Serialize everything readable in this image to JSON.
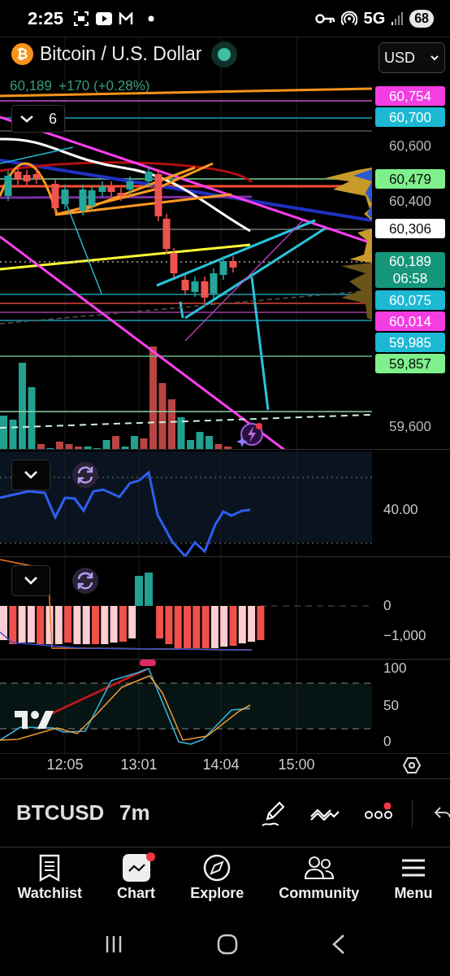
{
  "status_bar": {
    "time": "2:25",
    "network": "5G",
    "battery": "68"
  },
  "header": {
    "symbol_icon": "₿",
    "title": "Bitcoin / U.S. Dollar",
    "currency": "USD"
  },
  "quote": {
    "price": "60,189",
    "change": "+170 (+0.28%)"
  },
  "layout_button": {
    "count": "6"
  },
  "price_labels": [
    {
      "text": "60,754",
      "kind": "tag",
      "color": "#f43ee4"
    },
    {
      "text": "60,700",
      "kind": "tag",
      "color": "#1cb8d4"
    },
    {
      "text": "60,600",
      "kind": "plain"
    },
    {
      "text": "60,479",
      "kind": "tag",
      "color": "#7ff08c"
    },
    {
      "text": "60,400",
      "kind": "plain"
    },
    {
      "text": "60,306",
      "kind": "tag",
      "color": "#ffffff"
    },
    {
      "text": "60,189",
      "subtext": "06:58",
      "kind": "tag",
      "color": "#15967a"
    },
    {
      "text": "60,075",
      "kind": "tag",
      "color": "#1cb8d4"
    },
    {
      "text": "60,014",
      "kind": "tag",
      "color": "#f43ee4"
    },
    {
      "text": "59,985",
      "kind": "tag",
      "color": "#1cb8d4"
    },
    {
      "text": "59,857",
      "kind": "tag",
      "color": "#7ff08c"
    },
    {
      "text": "59,600",
      "kind": "plain"
    }
  ],
  "rsi_pane": {
    "labels": [
      "40.00"
    ]
  },
  "macd_pane": {
    "labels": [
      "0",
      "−1,000"
    ]
  },
  "stoch_pane": {
    "labels": [
      "100",
      "50",
      "0"
    ]
  },
  "time_axis": [
    "12:05",
    "13:01",
    "14:04",
    "15:00"
  ],
  "toolbar": {
    "symbol": "BTCUSD",
    "interval": "7m",
    "more_notification": true
  },
  "nav": [
    {
      "label": "Watchlist",
      "selected": false,
      "notification": false
    },
    {
      "label": "Chart",
      "selected": true,
      "notification": true
    },
    {
      "label": "Explore",
      "selected": false,
      "notification": false
    },
    {
      "label": "Community",
      "selected": false,
      "notification": false
    },
    {
      "label": "Menu",
      "selected": false,
      "notification": false
    }
  ]
}
